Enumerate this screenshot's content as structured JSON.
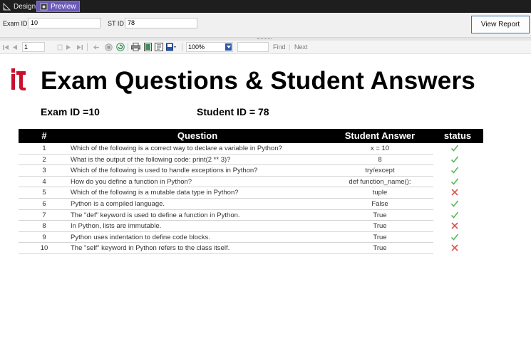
{
  "topbar": {
    "design_label": "Design",
    "preview_label": "Preview"
  },
  "params": {
    "exam_id_label": "Exam ID",
    "exam_id_value": "10",
    "st_id_label": "ST ID",
    "st_id_value": "78",
    "view_report_label": "View Report"
  },
  "toolbar": {
    "page_value": "1",
    "zoom_value": "100%",
    "find_label": "Find",
    "next_label": "Next",
    "search_value": ""
  },
  "report": {
    "title": "Exam Questions & Student Answers",
    "exam_info": "Exam ID =10",
    "student_info": "Student ID =  78",
    "headers": {
      "num": "#",
      "question": "Question",
      "answer": "Student Answer",
      "status": "status"
    },
    "rows": [
      {
        "num": "1",
        "question": "Which of the following is a correct way to declare a variable in Python?",
        "answer": "x = 10",
        "status": "correct"
      },
      {
        "num": "2",
        "question": "What is the output of the following code: print(2 ** 3)?",
        "answer": "8",
        "status": "correct"
      },
      {
        "num": "3",
        "question": "Which of the following is used to handle exceptions in Python?",
        "answer": "try/except",
        "status": "correct"
      },
      {
        "num": "4",
        "question": "How do you define a function in Python?",
        "answer": "def function_name():",
        "status": "correct"
      },
      {
        "num": "5",
        "question": "Which of the following is a mutable data type in Python?",
        "answer": "tuple",
        "status": "wrong"
      },
      {
        "num": "6",
        "question": "Python is a compiled language.",
        "answer": "False",
        "status": "correct"
      },
      {
        "num": "7",
        "question": "The \"def\" keyword is used to define a function in Python.",
        "answer": "True",
        "status": "correct"
      },
      {
        "num": "8",
        "question": "In Python, lists are immutable.",
        "answer": "True",
        "status": "wrong"
      },
      {
        "num": "9",
        "question": "Python uses indentation to define code blocks.",
        "answer": "True",
        "status": "correct"
      },
      {
        "num": "10",
        "question": "The \"self\" keyword in Python refers to the class itself.",
        "answer": "True",
        "status": "wrong"
      }
    ]
  },
  "colors": {
    "accent": "#6c5ab8",
    "correct": "#5cb85c",
    "wrong": "#d9534f",
    "logo": "#c8102e"
  }
}
